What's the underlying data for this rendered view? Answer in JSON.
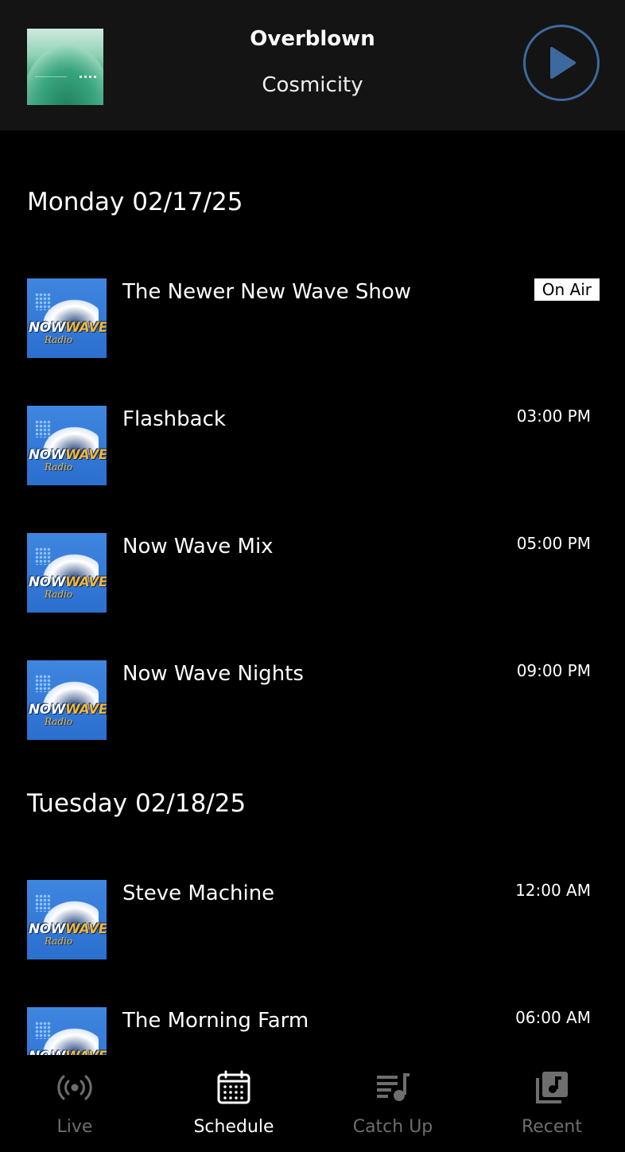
{
  "now_playing": {
    "title": "Overblown",
    "artist": "Cosmicity",
    "play_icon": "play-icon",
    "accent": "#3d6a9e"
  },
  "schedule": {
    "days": [
      {
        "label": "Monday 02/17/25",
        "shows": [
          {
            "name": "The Newer New Wave Show",
            "time": "On Air",
            "on_air": true
          },
          {
            "name": "Flashback",
            "time": "03:00 PM"
          },
          {
            "name": "Now Wave Mix",
            "time": "05:00 PM"
          },
          {
            "name": "Now Wave Nights",
            "time": "09:00 PM"
          }
        ]
      },
      {
        "label": "Tuesday 02/18/25",
        "shows": [
          {
            "name": "Steve Machine",
            "time": "12:00 AM"
          },
          {
            "name": "The Morning Farm",
            "time": "06:00 AM"
          }
        ]
      }
    ]
  },
  "show_logo": {
    "word1": "NOW",
    "word2": "WAVE",
    "sub": "Radio"
  },
  "tabs": [
    {
      "label": "Live",
      "icon": "broadcast-icon",
      "active": false
    },
    {
      "label": "Schedule",
      "icon": "calendar-icon",
      "active": true
    },
    {
      "label": "Catch Up",
      "icon": "playlist-icon",
      "active": false
    },
    {
      "label": "Recent",
      "icon": "music-library-icon",
      "active": false
    }
  ]
}
